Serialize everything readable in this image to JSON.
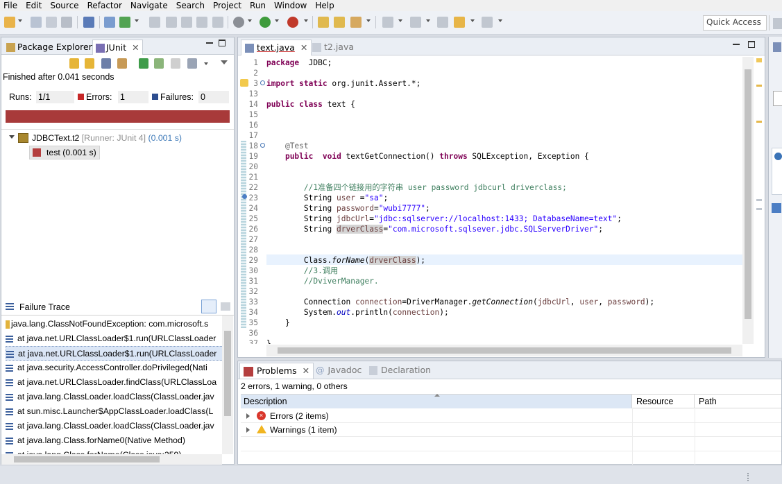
{
  "menubar": {
    "items": [
      "File",
      "Edit",
      "Source",
      "Refactor",
      "Navigate",
      "Search",
      "Project",
      "Run",
      "Window",
      "Help"
    ]
  },
  "toolbar": {
    "quick_access_placeholder": "Quick Access"
  },
  "left_panel": {
    "tabs": [
      {
        "label": "Package Explorer",
        "icon": "package-icon"
      },
      {
        "label": "JUnit",
        "icon": "junit-icon",
        "active": true
      }
    ],
    "status": "Finished after 0.041 seconds",
    "runs_label": "Runs:",
    "runs_value": "1/1",
    "errors_label": "Errors:",
    "errors_value": "1",
    "failures_label": "Failures:",
    "failures_value": "0",
    "progress_color": "#a83a3a",
    "progress_fraction": 1.0,
    "tree": {
      "root_label": "JDBCText.t2",
      "root_runner": "[Runner: JUnit 4]",
      "root_time": "(0.001 s)",
      "child_label": "test (0.001 s)"
    },
    "failure_trace": {
      "title": "Failure Trace",
      "lines": [
        "java.lang.ClassNotFoundException: com.microsoft.s",
        "at java.net.URLClassLoader$1.run(URLClassLoader",
        "at java.net.URLClassLoader$1.run(URLClassLoader",
        "at java.security.AccessController.doPrivileged(Nati",
        "at java.net.URLClassLoader.findClass(URLClassLoa",
        "at java.lang.ClassLoader.loadClass(ClassLoader.jav",
        "at sun.misc.Launcher$AppClassLoader.loadClass(L",
        "at java.lang.ClassLoader.loadClass(ClassLoader.jav",
        "at java.lang.Class.forName0(Native Method)",
        "at java.lang.Class.forName(Class.java:259)"
      ]
    }
  },
  "editor": {
    "tabs": [
      {
        "label": "text.java",
        "active": true
      },
      {
        "label": "t2.java",
        "active": false
      }
    ],
    "lines": [
      {
        "n": "1",
        "segs": [
          [
            "kw",
            "package"
          ],
          [
            "",
            "  JDBC;"
          ]
        ]
      },
      {
        "n": "2",
        "segs": []
      },
      {
        "n": "3",
        "segs": [
          [
            "kw",
            "import"
          ],
          [
            "",
            " "
          ],
          [
            "kw",
            "static"
          ],
          [
            "",
            " org.junit.Assert.*;"
          ]
        ]
      },
      {
        "n": "13",
        "segs": []
      },
      {
        "n": "14",
        "segs": [
          [
            "kw",
            "public"
          ],
          [
            "",
            " "
          ],
          [
            "kw",
            "class"
          ],
          [
            "",
            " text {"
          ]
        ]
      },
      {
        "n": "15",
        "segs": []
      },
      {
        "n": "16",
        "segs": []
      },
      {
        "n": "17",
        "segs": []
      },
      {
        "n": "18",
        "segs": [
          [
            "",
            "    "
          ],
          [
            "ann",
            "@Test"
          ]
        ]
      },
      {
        "n": "19",
        "segs": [
          [
            "",
            "    "
          ],
          [
            "kw",
            "public"
          ],
          [
            "",
            "  "
          ],
          [
            "kw",
            "void"
          ],
          [
            "",
            " textGetConnection() "
          ],
          [
            "kw",
            "throws"
          ],
          [
            "",
            " SQLException, Exception {"
          ]
        ]
      },
      {
        "n": "20",
        "segs": []
      },
      {
        "n": "21",
        "segs": []
      },
      {
        "n": "22",
        "segs": [
          [
            "",
            "        "
          ],
          [
            "cmt",
            "//1准备四个链接用的字符串 user password jdbcurl driverclass;"
          ]
        ]
      },
      {
        "n": "23",
        "segs": [
          [
            "",
            "        String "
          ],
          [
            "var",
            "user"
          ],
          [
            "",
            " ="
          ],
          [
            "str",
            "\"sa\""
          ],
          [
            "",
            ";"
          ]
        ]
      },
      {
        "n": "24",
        "segs": [
          [
            "",
            "        String "
          ],
          [
            "var",
            "password"
          ],
          [
            "",
            "="
          ],
          [
            "str",
            "\"wubi7777\""
          ],
          [
            "",
            ";"
          ]
        ]
      },
      {
        "n": "25",
        "segs": [
          [
            "",
            "        String "
          ],
          [
            "var",
            "jdbcUrl"
          ],
          [
            "",
            "="
          ],
          [
            "str",
            "\"jdbc:sqlserver://localhost:1433; DatabaseName=text\""
          ],
          [
            "",
            ";"
          ]
        ]
      },
      {
        "n": "26",
        "segs": [
          [
            "",
            "        String "
          ],
          [
            "hl-var",
            "drverClass"
          ],
          [
            "",
            "="
          ],
          [
            "str",
            "\"com.microsoft.sqlsever.jdbc.SQLServerDriver\""
          ],
          [
            "",
            ";"
          ]
        ]
      },
      {
        "n": "27",
        "segs": []
      },
      {
        "n": "28",
        "segs": []
      },
      {
        "n": "29",
        "segs": [
          [
            "",
            "        Class."
          ],
          [
            "it",
            "forName"
          ],
          [
            "",
            "("
          ],
          [
            "hl-var",
            "drverClass"
          ],
          [
            "",
            ");"
          ]
        ]
      },
      {
        "n": "30",
        "segs": [
          [
            "",
            "        "
          ],
          [
            "cmt",
            "//3.调用"
          ]
        ]
      },
      {
        "n": "31",
        "segs": [
          [
            "",
            "        "
          ],
          [
            "cmt",
            "//DviverManager."
          ]
        ]
      },
      {
        "n": "32",
        "segs": []
      },
      {
        "n": "33",
        "segs": [
          [
            "",
            "        Connection "
          ],
          [
            "var",
            "connection"
          ],
          [
            "",
            "=DriverManager."
          ],
          [
            "it",
            "getConnection"
          ],
          [
            "",
            "("
          ],
          [
            "var",
            "jdbcUrl"
          ],
          [
            "",
            ", "
          ],
          [
            "var",
            "user"
          ],
          [
            "",
            ", "
          ],
          [
            "var",
            "password"
          ],
          [
            "",
            ");"
          ]
        ]
      },
      {
        "n": "34",
        "segs": [
          [
            "",
            "        System."
          ],
          [
            "fld",
            "out"
          ],
          [
            "",
            ".println("
          ],
          [
            "var",
            "connection"
          ],
          [
            "",
            ");"
          ]
        ]
      },
      {
        "n": "35",
        "segs": [
          [
            "",
            "    }"
          ]
        ]
      },
      {
        "n": "36",
        "segs": []
      },
      {
        "n": "37",
        "segs": [
          [
            "",
            "}"
          ]
        ]
      }
    ]
  },
  "problems": {
    "tabs": [
      {
        "label": "Problems",
        "active": true
      },
      {
        "label": "Javadoc",
        "active": false
      },
      {
        "label": "Declaration",
        "active": false
      }
    ],
    "summary": "2 errors, 1 warning, 0 others",
    "columns": [
      "Description",
      "Resource",
      "Path"
    ],
    "rows": [
      {
        "label": "Errors (2 items)",
        "icon": "error-icon"
      },
      {
        "label": "Warnings (1 item)",
        "icon": "warning-icon"
      }
    ]
  }
}
